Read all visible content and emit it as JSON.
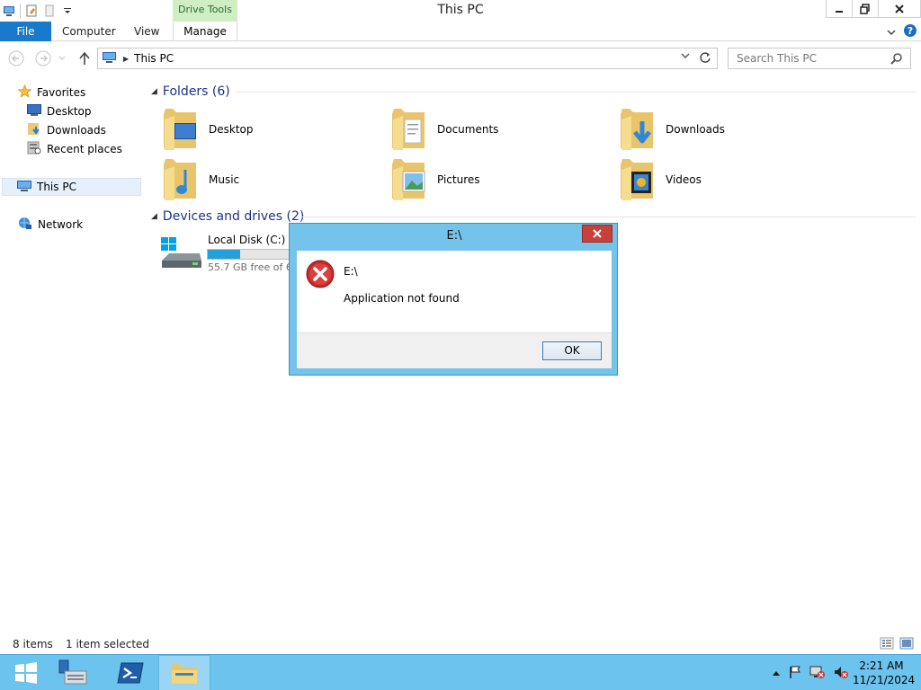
{
  "window": {
    "title": "This PC",
    "contextual_tab": "Drive Tools",
    "buttons": [
      "minimize",
      "restore",
      "close"
    ]
  },
  "ribbon": {
    "file_label": "File",
    "tabs": [
      "Computer",
      "View",
      "Manage"
    ]
  },
  "address": {
    "path": "This PC",
    "search_placeholder": "Search This PC"
  },
  "nav": {
    "favorites": "Favorites",
    "desktop": "Desktop",
    "downloads": "Downloads",
    "recent": "Recent places",
    "thispc": "This PC",
    "network": "Network"
  },
  "content": {
    "folders_header": "Folders (6)",
    "folders": [
      "Desktop",
      "Documents",
      "Downloads",
      "Music",
      "Pictures",
      "Videos"
    ],
    "drives_header": "Devices and drives (2)",
    "drive": {
      "name": "Local Disk (C:)",
      "free": "55.7 GB free of 69",
      "used_fraction": 0.38
    }
  },
  "status": {
    "items": "8 items",
    "selected": "1 item selected"
  },
  "dialog": {
    "title": "E:\\",
    "heading": "E:\\",
    "message": "Application not found",
    "ok": "OK"
  },
  "taskbar": {
    "time": "2:21 AM",
    "date": "11/21/2024"
  },
  "colors": {
    "accent": "#1979ca",
    "taskbar": "#6cc3ee",
    "dialog_frame": "#73c3ea",
    "close_red": "#c9403a",
    "drivetools_green": "#cfeec3",
    "section_header": "#1e3287"
  }
}
